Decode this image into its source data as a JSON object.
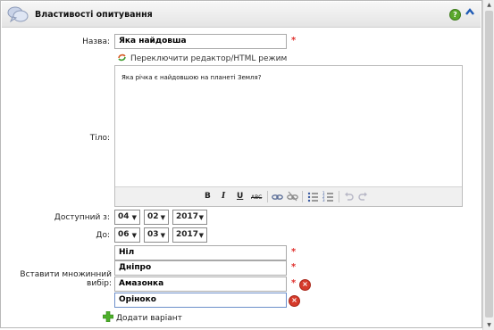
{
  "header": {
    "title": "Властивості опитування"
  },
  "form": {
    "name_label": "Назва:",
    "name_value": "Яка найдовша",
    "switch_editor_label": "Переключити редактор/HTML режим",
    "body_label": "Тіло:",
    "body_text": "Яка річка є найдовшою на планеті Земля?",
    "available_from_label": "Доступний з:",
    "available_to_label": "До:",
    "from": {
      "day": "04",
      "month": "02",
      "year": "2017"
    },
    "to": {
      "day": "06",
      "month": "03",
      "year": "2017"
    },
    "choices_label": "Вставити множинний вибір:",
    "choices": [
      "Ніл",
      "Дніпро",
      "Амазонка",
      "Оріноко"
    ],
    "add_choice_label": "Додати варіант"
  },
  "toolbar": {
    "bold": "B",
    "italic": "I",
    "underline": "U",
    "strike": "ABC"
  },
  "icons": {
    "header": "speech-bubbles-icon",
    "help": "help-icon",
    "collapse": "collapse-arrow-icon",
    "switch": "refresh-icon",
    "delete": "delete-icon",
    "add": "add-icon"
  },
  "colors": {
    "required": "#e0322f",
    "delete": "#d63a2a",
    "add": "#4caf2a",
    "help": "#5aa82c"
  }
}
